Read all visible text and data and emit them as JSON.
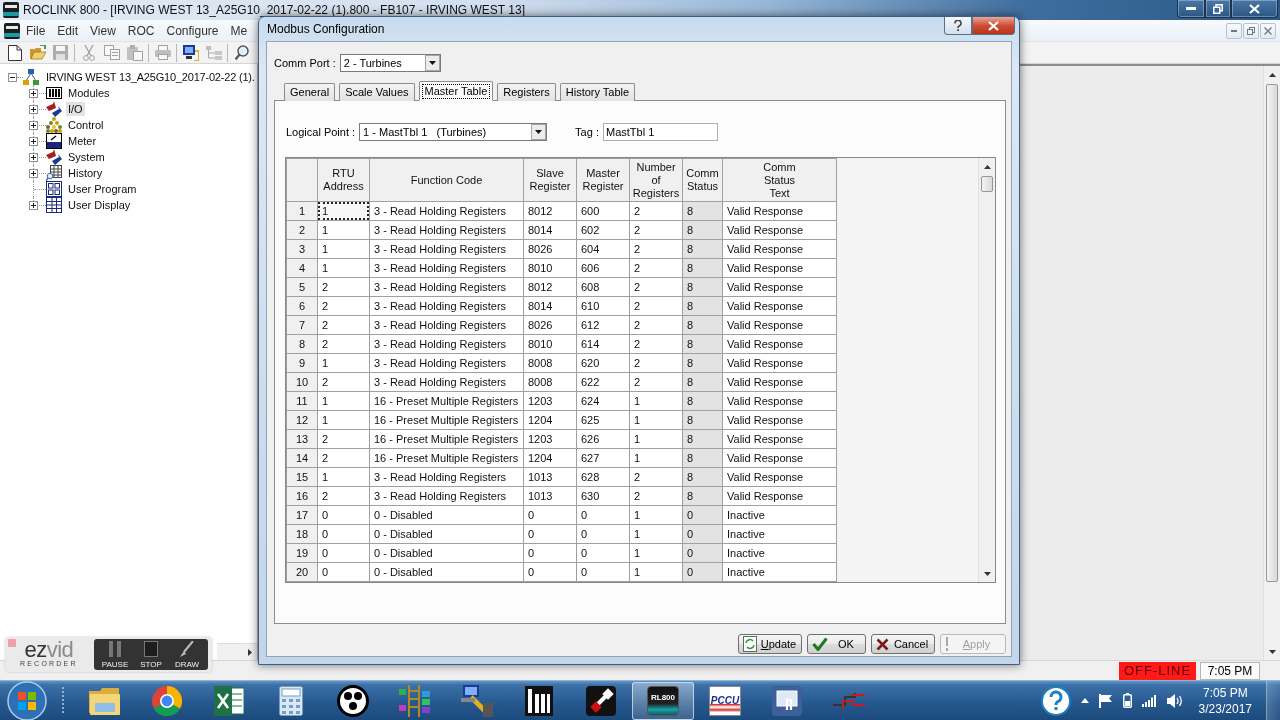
{
  "app_window": {
    "title": "ROCLINK 800 - [IRVING WEST 13_A25G10_2017-02-22 (1).800 - FB107 - IRVING WEST 13]"
  },
  "menu": [
    "File",
    "Edit",
    "View",
    "ROC",
    "Configure",
    "Me"
  ],
  "toolbar": [
    [
      {
        "disabled": false
      },
      {
        "disabled": false
      },
      {
        "disabled": true
      }
    ],
    [
      {
        "disabled": true
      },
      {
        "disabled": true
      },
      {
        "disabled": true
      }
    ],
    [
      {
        "disabled": true
      }
    ],
    [
      {
        "disabled": false
      },
      {
        "disabled": true
      }
    ],
    [
      {
        "disabled": false
      }
    ]
  ],
  "tree": {
    "label": "IRVING WEST 13_A25G10_2017-02-22 (1).",
    "expanded": true,
    "selected": false,
    "children": [
      {
        "label": "Modules",
        "kind": "branch",
        "expanded": false,
        "selected": false
      },
      {
        "label": "I/O",
        "kind": "branch",
        "expanded": false,
        "selected": true
      },
      {
        "label": "Control",
        "kind": "branch",
        "expanded": false,
        "selected": false
      },
      {
        "label": "Meter",
        "kind": "branch",
        "expanded": false,
        "selected": false
      },
      {
        "label": "System",
        "kind": "branch",
        "expanded": false,
        "selected": false
      },
      {
        "label": "History",
        "kind": "branch",
        "expanded": false,
        "selected": false
      },
      {
        "label": "User Program",
        "kind": "leaf",
        "selected": false
      },
      {
        "label": "User Display",
        "kind": "branch",
        "expanded": false,
        "selected": false
      }
    ]
  },
  "status_bar": {
    "connection": "OFF-LINE",
    "time": "7:05 PM"
  },
  "dialog": {
    "title": "Modbus Configuration",
    "comm_port": {
      "label": "Comm Port :",
      "value": "2 - Turbines"
    },
    "tabs": [
      {
        "label": "General",
        "selected": false
      },
      {
        "label": "Scale Values",
        "selected": false
      },
      {
        "label": "Master Table",
        "selected": true
      },
      {
        "label": "Registers",
        "selected": false
      },
      {
        "label": "History Table",
        "selected": false
      }
    ],
    "logical_point": {
      "label": "Logical Point :",
      "value": "1 - MastTbl 1   (Turbines)"
    },
    "tag": {
      "label": "Tag :",
      "value": "MastTbl 1"
    },
    "table": {
      "columns": [
        {
          "label": "RTU\nAddress",
          "read_only": false
        },
        {
          "label": "Function Code",
          "read_only": false
        },
        {
          "label": "Slave\nRegister",
          "read_only": false
        },
        {
          "label": "Master\nRegister",
          "read_only": false
        },
        {
          "label": "Number\nof\nRegisters",
          "read_only": false
        },
        {
          "label": "Comm\nStatus",
          "read_only": true
        },
        {
          "label": "Comm\nStatus\nText",
          "read_only": false
        }
      ],
      "rows": [
        {
          "number": "1",
          "focused": true,
          "cells": [
            "1",
            "3 - Read Holding Registers",
            "8012",
            "600",
            "2",
            "8",
            "Valid Response"
          ]
        },
        {
          "number": "2",
          "focused": false,
          "cells": [
            "1",
            "3 - Read Holding Registers",
            "8014",
            "602",
            "2",
            "8",
            "Valid Response"
          ]
        },
        {
          "number": "3",
          "focused": false,
          "cells": [
            "1",
            "3 - Read Holding Registers",
            "8026",
            "604",
            "2",
            "8",
            "Valid Response"
          ]
        },
        {
          "number": "4",
          "focused": false,
          "cells": [
            "1",
            "3 - Read Holding Registers",
            "8010",
            "606",
            "2",
            "8",
            "Valid Response"
          ]
        },
        {
          "number": "5",
          "focused": false,
          "cells": [
            "2",
            "3 - Read Holding Registers",
            "8012",
            "608",
            "2",
            "8",
            "Valid Response"
          ]
        },
        {
          "number": "6",
          "focused": false,
          "cells": [
            "2",
            "3 - Read Holding Registers",
            "8014",
            "610",
            "2",
            "8",
            "Valid Response"
          ]
        },
        {
          "number": "7",
          "focused": false,
          "cells": [
            "2",
            "3 - Read Holding Registers",
            "8026",
            "612",
            "2",
            "8",
            "Valid Response"
          ]
        },
        {
          "number": "8",
          "focused": false,
          "cells": [
            "2",
            "3 - Read Holding Registers",
            "8010",
            "614",
            "2",
            "8",
            "Valid Response"
          ]
        },
        {
          "number": "9",
          "focused": false,
          "cells": [
            "1",
            "3 - Read Holding Registers",
            "8008",
            "620",
            "2",
            "8",
            "Valid Response"
          ]
        },
        {
          "number": "10",
          "focused": false,
          "cells": [
            "2",
            "3 - Read Holding Registers",
            "8008",
            "622",
            "2",
            "8",
            "Valid Response"
          ]
        },
        {
          "number": "11",
          "focused": false,
          "cells": [
            "1",
            "16 - Preset Multiple Registers",
            "1203",
            "624",
            "1",
            "8",
            "Valid Response"
          ]
        },
        {
          "number": "12",
          "focused": false,
          "cells": [
            "1",
            "16 - Preset Multiple Registers",
            "1204",
            "625",
            "1",
            "8",
            "Valid Response"
          ]
        },
        {
          "number": "13",
          "focused": false,
          "cells": [
            "2",
            "16 - Preset Multiple Registers",
            "1203",
            "626",
            "1",
            "8",
            "Valid Response"
          ]
        },
        {
          "number": "14",
          "focused": false,
          "cells": [
            "2",
            "16 - Preset Multiple Registers",
            "1204",
            "627",
            "1",
            "8",
            "Valid Response"
          ]
        },
        {
          "number": "15",
          "focused": false,
          "cells": [
            "1",
            "3 - Read Holding Registers",
            "1013",
            "628",
            "2",
            "8",
            "Valid Response"
          ]
        },
        {
          "number": "16",
          "focused": false,
          "cells": [
            "2",
            "3 - Read Holding Registers",
            "1013",
            "630",
            "2",
            "8",
            "Valid Response"
          ]
        },
        {
          "number": "17",
          "focused": false,
          "cells": [
            "0",
            "0 - Disabled",
            "0",
            "0",
            "1",
            "0",
            "Inactive"
          ]
        },
        {
          "number": "18",
          "focused": false,
          "cells": [
            "0",
            "0 - Disabled",
            "0",
            "0",
            "1",
            "0",
            "Inactive"
          ]
        },
        {
          "number": "19",
          "focused": false,
          "cells": [
            "0",
            "0 - Disabled",
            "0",
            "0",
            "1",
            "0",
            "Inactive"
          ]
        },
        {
          "number": "20",
          "focused": false,
          "cells": [
            "0",
            "0 - Disabled",
            "0",
            "0",
            "1",
            "0",
            "Inactive"
          ]
        }
      ]
    },
    "buttons": [
      {
        "label": "Update",
        "kind": "update",
        "disabled": false,
        "access_key": true
      },
      {
        "label": "OK",
        "kind": "ok",
        "disabled": false,
        "access_key": false
      },
      {
        "label": "Cancel",
        "kind": "cancel",
        "disabled": false,
        "access_key": false
      },
      {
        "label": "Apply",
        "kind": "apply",
        "disabled": true,
        "access_key": true
      }
    ]
  },
  "recorder": {
    "logo": [
      "ez",
      "vid"
    ],
    "subtitle": "RECORDER",
    "buttons": [
      "PAUSE",
      "STOP",
      "DRAW"
    ]
  },
  "taskbar": {
    "apps": [
      {
        "active": false
      },
      {
        "active": false
      },
      {
        "active": false
      },
      {
        "active": false
      },
      {
        "active": false
      },
      {
        "active": false
      },
      {
        "active": false
      },
      {
        "active": false
      },
      {
        "active": false
      },
      {
        "label": "RL800",
        "active": true
      },
      {
        "label": "PCCU",
        "active": false
      },
      {
        "active": false
      },
      {
        "active": false
      }
    ],
    "clock": {
      "time": "7:05 PM",
      "date": "3/23/2017"
    }
  }
}
